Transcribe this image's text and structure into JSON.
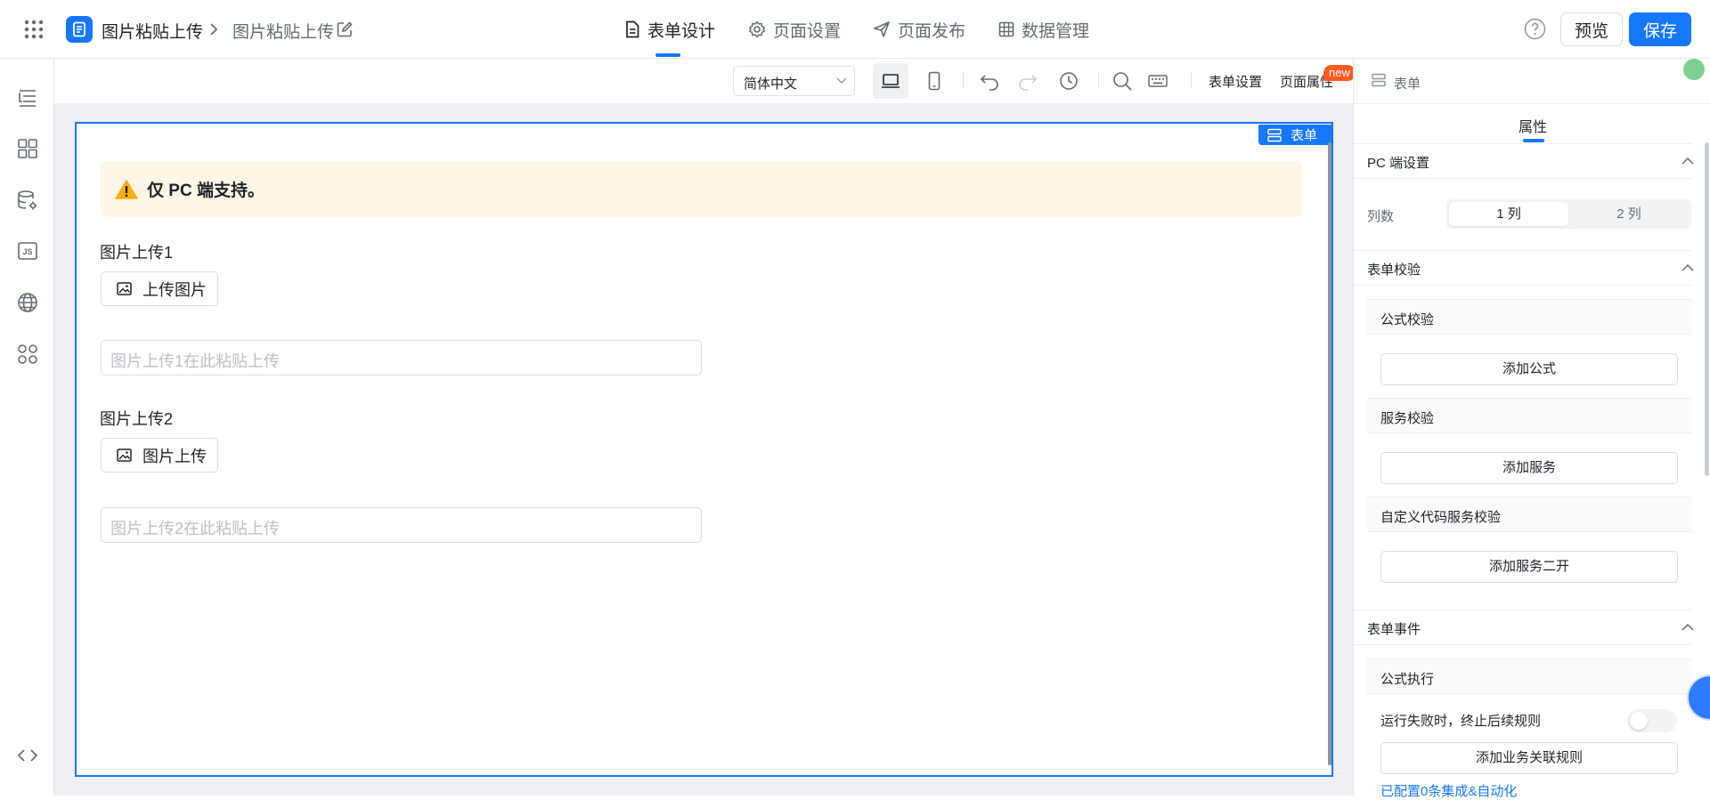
{
  "header": {
    "breadcrumb": [
      "图片粘贴上传",
      "图片粘贴上传"
    ],
    "tabs": [
      {
        "label": "表单设计",
        "icon": "file-icon",
        "active": true
      },
      {
        "label": "页面设置",
        "icon": "gear-icon"
      },
      {
        "label": "页面发布",
        "icon": "send-icon"
      },
      {
        "label": "数据管理",
        "icon": "table-icon"
      }
    ],
    "preview_label": "预览",
    "save_label": "保存",
    "accent_color": "#1677ff"
  },
  "sidebar": {
    "items": [
      "outline-icon",
      "components-icon",
      "datasource-icon",
      "js-icon",
      "globe-icon",
      "plugins-icon",
      "code-icon"
    ]
  },
  "toolbar": {
    "language": "简体中文",
    "form_settings": "表单设置",
    "page_props": "页面属性",
    "new_badge": "new"
  },
  "canvas": {
    "form_tag": "表单",
    "alert": "仅 PC 端支持。",
    "fields": [
      {
        "label": "图片上传1",
        "button": "上传图片",
        "placeholder": "图片上传1在此粘贴上传"
      },
      {
        "label": "图片上传2",
        "button": "图片上传",
        "placeholder": "图片上传2在此粘贴上传"
      }
    ]
  },
  "panel": {
    "breadcrumb": "表单",
    "tab": "属性",
    "pc_settings": {
      "title": "PC 端设置",
      "columns_label": "列数",
      "options": [
        "1 列",
        "2 列"
      ],
      "selected": "1 列"
    },
    "validation": {
      "title": "表单校验",
      "formula_title": "公式校验",
      "formula_btn": "添加公式",
      "service_title": "服务校验",
      "service_btn": "添加服务",
      "custom_title": "自定义代码服务校验",
      "custom_btn": "添加服务二开"
    },
    "events": {
      "title": "表单事件",
      "formula_exec": "公式执行",
      "fail_stop_label": "运行失败时，终止后续规则",
      "fail_stop_on": false,
      "add_rule_btn": "添加业务关联规则",
      "configured_link": "已配置0条集成&自动化"
    }
  }
}
